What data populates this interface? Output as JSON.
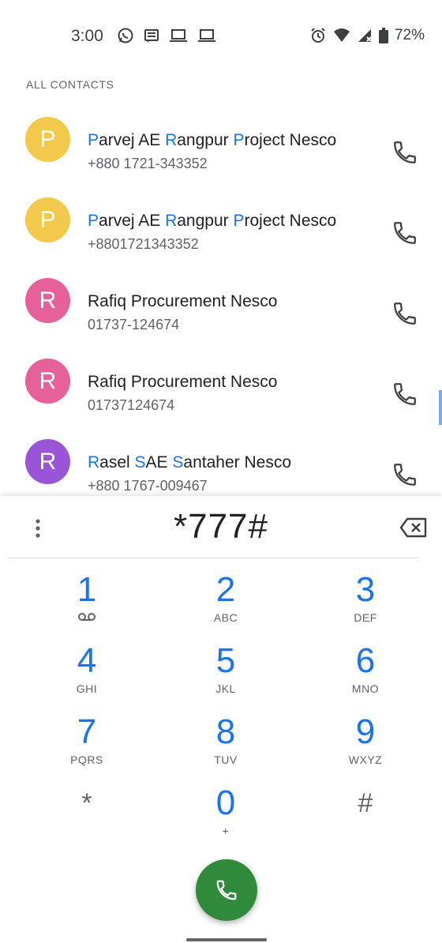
{
  "status_bar": {
    "time": "3:00",
    "battery": "72%",
    "left_icons": [
      "whatsapp-icon",
      "message-icon",
      "laptop-icon",
      "laptop-icon"
    ],
    "right_icons": [
      "alarm-icon",
      "wifi-icon",
      "signal-icon",
      "battery-icon"
    ]
  },
  "section_header": "ALL CONTACTS",
  "contacts": [
    {
      "initial": "P",
      "color": "#f2c94c",
      "name_parts": [
        [
          "P",
          true
        ],
        [
          "arvej AE ",
          false
        ],
        [
          "R",
          true
        ],
        [
          "angpur ",
          false
        ],
        [
          "P",
          true
        ],
        [
          "roject Nesco",
          false
        ]
      ],
      "number": "+880 1721-343352"
    },
    {
      "initial": "P",
      "color": "#f2c94c",
      "name_parts": [
        [
          "P",
          true
        ],
        [
          "arvej AE ",
          false
        ],
        [
          "R",
          true
        ],
        [
          "angpur ",
          false
        ],
        [
          "P",
          true
        ],
        [
          "roject Nesco",
          false
        ]
      ],
      "number": "+8801721343352"
    },
    {
      "initial": "R",
      "color": "#e6609a",
      "name_parts": [
        [
          "Rafiq Procurement Nesco",
          false
        ]
      ],
      "number": "01737-124674"
    },
    {
      "initial": "R",
      "color": "#e6609a",
      "name_parts": [
        [
          "Rafiq Procurement Nesco",
          false
        ]
      ],
      "number": "01737124674"
    },
    {
      "initial": "R",
      "color": "#9a54d8",
      "name_parts": [
        [
          "R",
          true
        ],
        [
          "asel ",
          false
        ],
        [
          "S",
          true
        ],
        [
          "AE ",
          false
        ],
        [
          "S",
          true
        ],
        [
          "antaher Nesco",
          false
        ]
      ],
      "number": "+880 1767-009467"
    }
  ],
  "dialer": {
    "digits": "*777#",
    "keys": [
      {
        "digit": "1",
        "sub": "voicemail-icon"
      },
      {
        "digit": "2",
        "sub": "ABC"
      },
      {
        "digit": "3",
        "sub": "DEF"
      },
      {
        "digit": "4",
        "sub": "GHI"
      },
      {
        "digit": "5",
        "sub": "JKL"
      },
      {
        "digit": "6",
        "sub": "MNO"
      },
      {
        "digit": "7",
        "sub": "PQRS"
      },
      {
        "digit": "8",
        "sub": "TUV"
      },
      {
        "digit": "9",
        "sub": "WXYZ"
      },
      {
        "digit": "*",
        "sub": ""
      },
      {
        "digit": "0",
        "sub": "+"
      },
      {
        "digit": "#",
        "sub": ""
      }
    ]
  },
  "colors": {
    "accent": "#1a73e8",
    "call_button": "#2f8a3b"
  }
}
